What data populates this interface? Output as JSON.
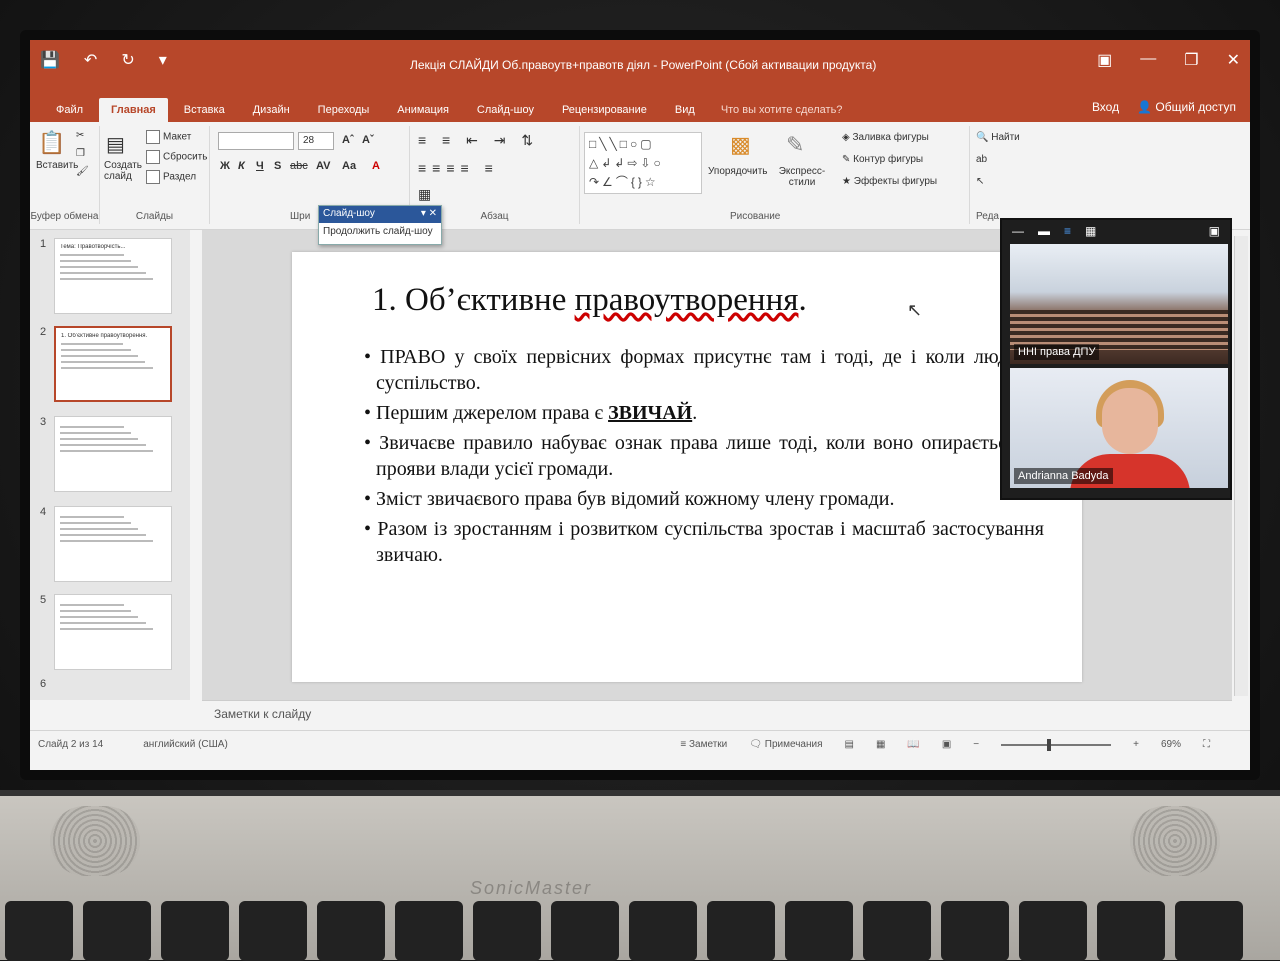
{
  "window": {
    "title": "Лекція СЛАЙДИ Об.правоутв+правотв діял - PowerPoint (Сбой активации продукта)",
    "sign_in": "Вход",
    "share": "Общий доступ"
  },
  "qat": {
    "save_icon": "save-icon",
    "undo_icon": "undo-icon",
    "redo_icon": "redo-icon"
  },
  "tabs": [
    "Файл",
    "Главная",
    "Вставка",
    "Дизайн",
    "Переходы",
    "Анимация",
    "Слайд-шоу",
    "Рецензирование",
    "Вид"
  ],
  "active_tab": "Главная",
  "tell_me": "Что вы хотите сделать?",
  "ribbon": {
    "clipboard": {
      "paste": "Вставить",
      "label": "Буфер обмена"
    },
    "slides": {
      "new_slide": "Создать слайд",
      "layout": "Макет",
      "reset": "Сбросить",
      "section": "Раздел",
      "label": "Слайды"
    },
    "font": {
      "size": "28",
      "bold": "Ж",
      "italic": "К",
      "underline": "Ч",
      "strike": "S",
      "shadow": "abc",
      "spacing": "AV",
      "case": "Aa",
      "label": "Шри"
    },
    "paragraph": {
      "label": "Абзац"
    },
    "drawing": {
      "arrange": "Упорядочить",
      "quick_styles": "Экспресс-стили",
      "fill": "Заливка фигуры",
      "outline": "Контур фигуры",
      "effects": "Эффекты фигуры",
      "label": "Рисование"
    },
    "editing": {
      "find": "Найти",
      "label": "Реда"
    }
  },
  "dropdown": {
    "header": "Слайд-шоу",
    "item": "Продолжить слайд-шоу"
  },
  "thumbnails": [
    {
      "num": "1",
      "title": "Тема: Правотворчість..."
    },
    {
      "num": "2",
      "title": "1. Об’єктивне правоутворення."
    },
    {
      "num": "3",
      "title": ""
    },
    {
      "num": "4",
      "title": ""
    },
    {
      "num": "5",
      "title": ""
    },
    {
      "num": "6",
      "title": ""
    }
  ],
  "slide": {
    "title_prefix": "1. Об’єктивне ",
    "title_underlined": "правоутворення",
    "title_suffix": ".",
    "bullets": [
      "ПРАВО у своїх первісних формах присутнє там і тоді, де і коли людське суспільство.",
      "Першим джерелом права є ",
      "Звичаєве правило набуває ознак права лише тоді, коли воно опирається на прояви влади усієї громади.",
      "Зміст звичаєвого права був відомий кожному члену громади.",
      "Разом із зростанням і розвитком суспільства зростав і масштаб застосування звичаю."
    ],
    "bullet2_bold": "ЗВИЧАЙ",
    "bullet2_end": "."
  },
  "notes_placeholder": "Заметки к слайду",
  "status": {
    "slide_info": "Слайд 2 из 14",
    "language": "английский (США)",
    "notes": "Заметки",
    "comments": "Примечания",
    "zoom": "69%",
    "zoom_level": 0.42
  },
  "meeting": {
    "tile1_label": "ННІ права ДПУ",
    "tile2_label": "Andrianna Badyda"
  },
  "laptop": {
    "brand": "SonicMaster"
  },
  "colors": {
    "accent": "#b7472a",
    "selection": "#2b579a"
  }
}
